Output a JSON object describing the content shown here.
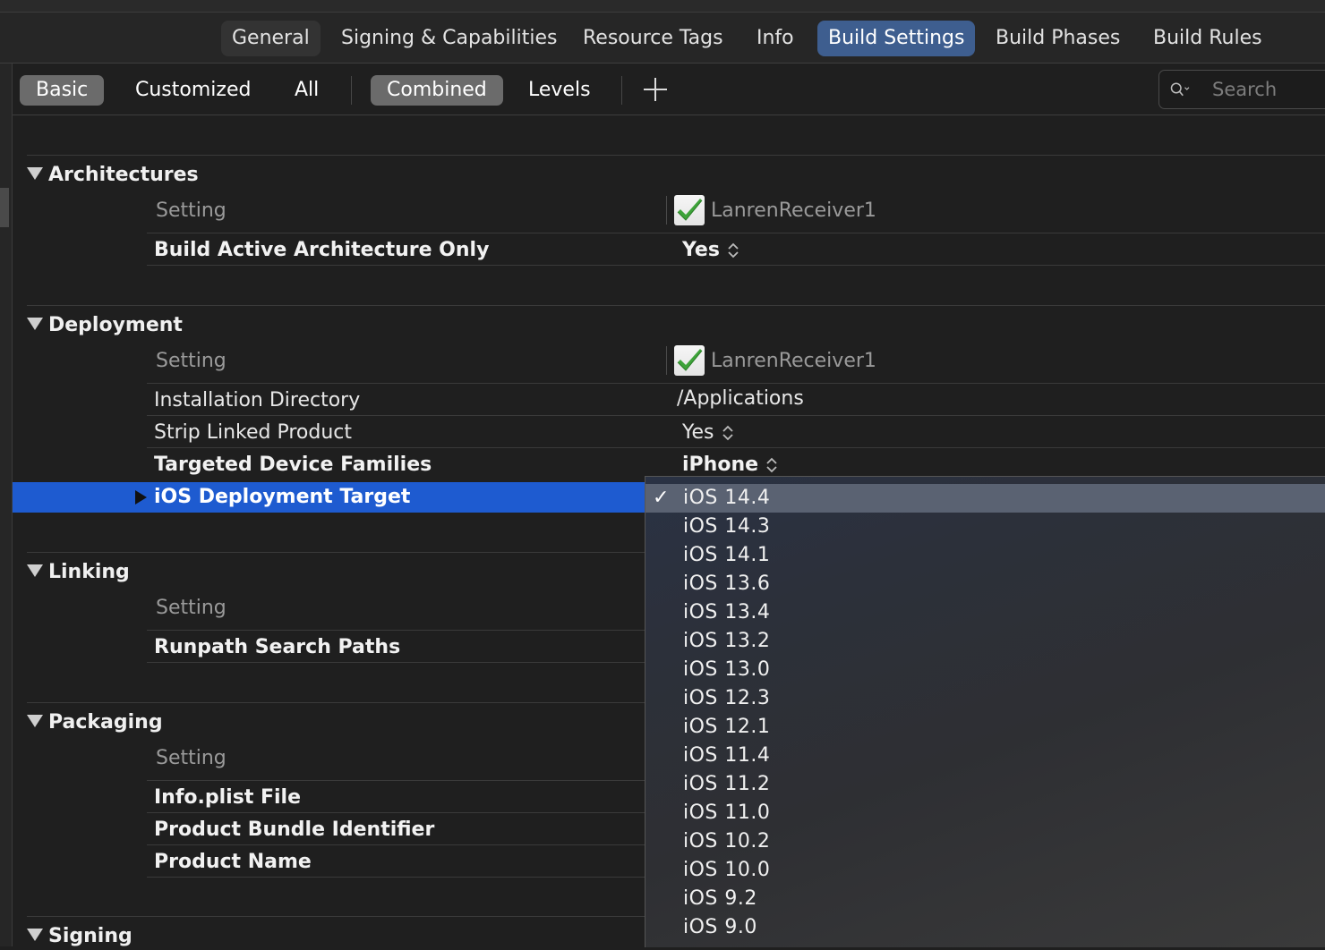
{
  "tabs": [
    "General",
    "Signing & Capabilities",
    "Resource Tags",
    "Info",
    "Build Settings",
    "Build Phases",
    "Build Rules"
  ],
  "active_tab": "Build Settings",
  "filters": {
    "basic": "Basic",
    "customized": "Customized",
    "all": "All",
    "combined": "Combined",
    "levels": "Levels"
  },
  "search": {
    "placeholder": "Search"
  },
  "sections": {
    "architectures": {
      "title": "Architectures",
      "header_setting": "Setting",
      "target": "LanrenReceiver1",
      "rows": [
        {
          "name": "Build Active Architecture Only",
          "value": "Yes"
        }
      ]
    },
    "deployment": {
      "title": "Deployment",
      "header_setting": "Setting",
      "target": "LanrenReceiver1",
      "rows": [
        {
          "name": "Installation Directory",
          "value": "/Applications"
        },
        {
          "name": "Strip Linked Product",
          "value": "Yes"
        },
        {
          "name": "Targeted Device Families",
          "value": "iPhone"
        },
        {
          "name": "iOS Deployment Target",
          "value": "iOS 14.4"
        }
      ]
    },
    "linking": {
      "title": "Linking",
      "header_setting": "Setting",
      "rows": [
        {
          "name": "Runpath Search Paths"
        }
      ]
    },
    "packaging": {
      "title": "Packaging",
      "header_setting": "Setting",
      "rows": [
        {
          "name": "Info.plist File"
        },
        {
          "name": "Product Bundle Identifier"
        },
        {
          "name": "Product Name"
        }
      ]
    },
    "signing": {
      "title": "Signing"
    }
  },
  "dropdown": {
    "selected": "iOS 14.4",
    "options": [
      "iOS 14.4",
      "iOS 14.3",
      "iOS 14.1",
      "iOS 13.6",
      "iOS 13.4",
      "iOS 13.2",
      "iOS 13.0",
      "iOS 12.3",
      "iOS 12.1",
      "iOS 11.4",
      "iOS 11.2",
      "iOS 11.0",
      "iOS 10.2",
      "iOS 10.0",
      "iOS 9.2",
      "iOS 9.0"
    ]
  },
  "colors": {
    "accent_tab": "#3e5e8f",
    "selection": "#1e5bd0",
    "background": "#1f1f1f"
  }
}
